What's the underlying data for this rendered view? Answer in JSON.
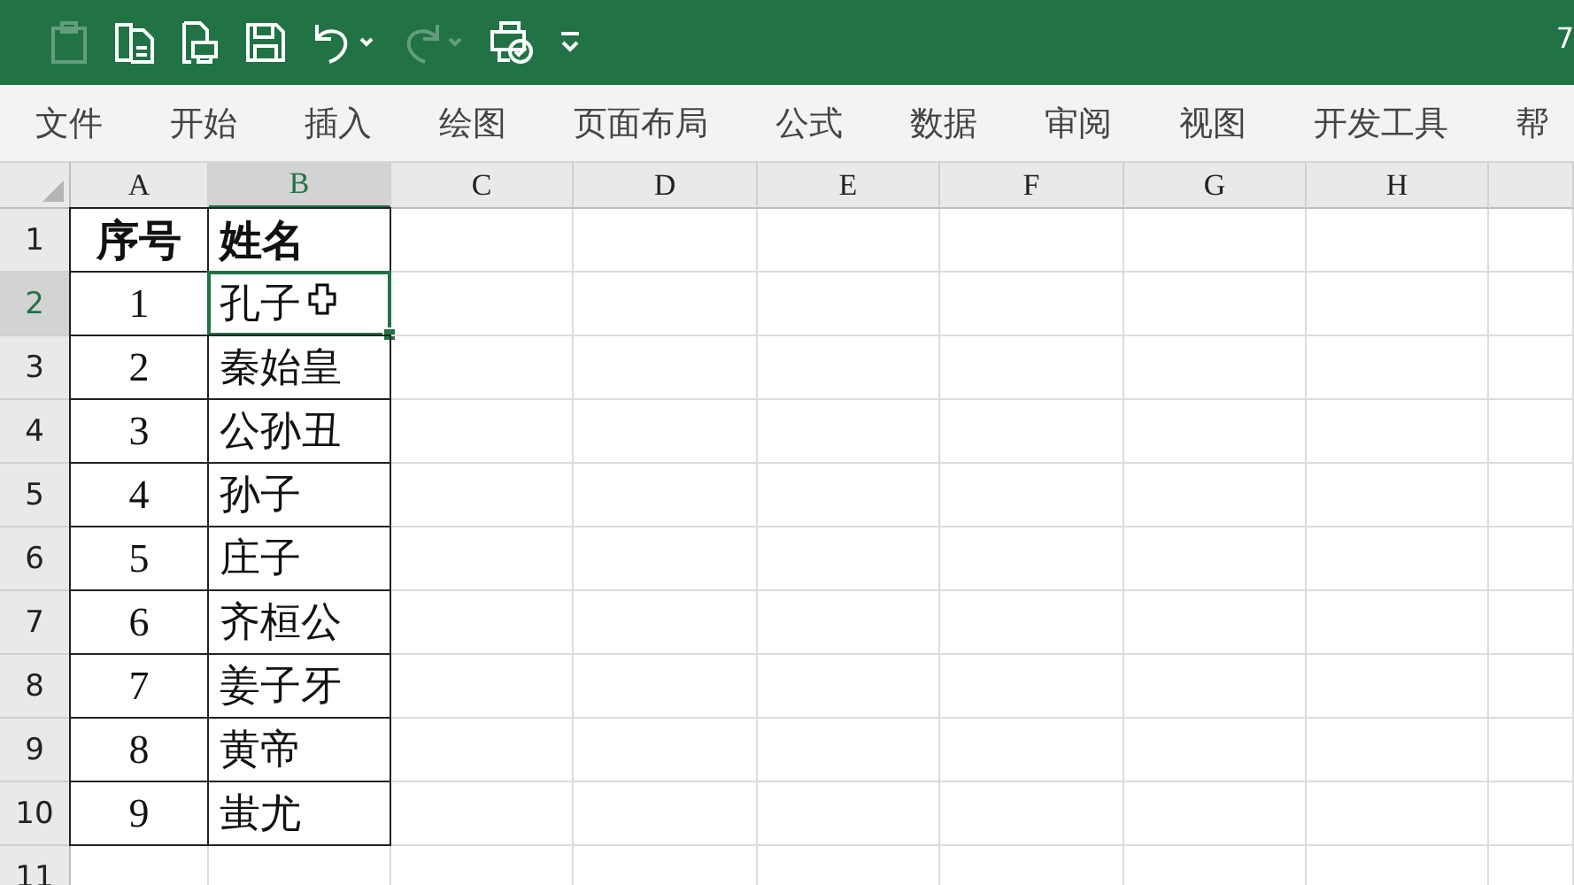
{
  "window": {
    "title": "7"
  },
  "quick_access_toolbar": [
    {
      "kind": "clipboard-numbers",
      "disabled": true
    },
    {
      "kind": "new-page",
      "disabled": false
    },
    {
      "kind": "print-preview",
      "disabled": false
    },
    {
      "kind": "save",
      "disabled": false
    },
    {
      "kind": "undo",
      "disabled": false
    },
    {
      "kind": "redo",
      "disabled": true
    },
    {
      "kind": "printer-check",
      "disabled": false
    },
    {
      "kind": "customize",
      "disabled": false
    }
  ],
  "ribbon_tabs": [
    {
      "label": "文件",
      "selected": false
    },
    {
      "label": "开始",
      "selected": false
    },
    {
      "label": "插入",
      "selected": false
    },
    {
      "label": "绘图",
      "selected": false
    },
    {
      "label": "页面布局",
      "selected": false
    },
    {
      "label": "公式",
      "selected": false
    },
    {
      "label": "数据",
      "selected": false
    },
    {
      "label": "审阅",
      "selected": false
    },
    {
      "label": "视图",
      "selected": false
    },
    {
      "label": "开发工具",
      "selected": false
    },
    {
      "label": "帮",
      "selected": false
    }
  ],
  "sheet": {
    "columns": [
      {
        "label": "A",
        "selected": false
      },
      {
        "label": "B",
        "selected": true
      },
      {
        "label": "C",
        "selected": false
      },
      {
        "label": "D",
        "selected": false
      },
      {
        "label": "E",
        "selected": false
      },
      {
        "label": "F",
        "selected": false
      },
      {
        "label": "G",
        "selected": false
      },
      {
        "label": "H",
        "selected": false
      }
    ],
    "rows": [
      {
        "number": "1",
        "selected": false,
        "cells": [
          {
            "text": "序号",
            "bold": true,
            "selected": false
          },
          {
            "text": "姓名",
            "bold": true,
            "selected": false
          }
        ]
      },
      {
        "number": "2",
        "selected": true,
        "cells": [
          {
            "text": "1",
            "bold": false,
            "selected": false
          },
          {
            "text": "孔子",
            "bold": false,
            "selected": true
          }
        ]
      },
      {
        "number": "3",
        "selected": false,
        "cells": [
          {
            "text": "2",
            "bold": false,
            "selected": false
          },
          {
            "text": "秦始皇",
            "bold": false,
            "selected": false
          }
        ]
      },
      {
        "number": "4",
        "selected": false,
        "cells": [
          {
            "text": "3",
            "bold": false,
            "selected": false
          },
          {
            "text": "公孙丑",
            "bold": false,
            "selected": false
          }
        ]
      },
      {
        "number": "5",
        "selected": false,
        "cells": [
          {
            "text": "4",
            "bold": false,
            "selected": false
          },
          {
            "text": "孙子",
            "bold": false,
            "selected": false
          }
        ]
      },
      {
        "number": "6",
        "selected": false,
        "cells": [
          {
            "text": "5",
            "bold": false,
            "selected": false
          },
          {
            "text": "庄子",
            "bold": false,
            "selected": false
          }
        ]
      },
      {
        "number": "7",
        "selected": false,
        "cells": [
          {
            "text": "6",
            "bold": false,
            "selected": false
          },
          {
            "text": "齐桓公",
            "bold": false,
            "selected": false
          }
        ]
      },
      {
        "number": "8",
        "selected": false,
        "cells": [
          {
            "text": "7",
            "bold": false,
            "selected": false
          },
          {
            "text": "姜子牙",
            "bold": false,
            "selected": false
          }
        ]
      },
      {
        "number": "9",
        "selected": false,
        "cells": [
          {
            "text": "8",
            "bold": false,
            "selected": false
          },
          {
            "text": "黄帝",
            "bold": false,
            "selected": false
          }
        ]
      },
      {
        "number": "10",
        "selected": false,
        "cells": [
          {
            "text": "9",
            "bold": false,
            "selected": false
          },
          {
            "text": "蚩尤",
            "bold": false,
            "selected": false
          }
        ]
      },
      {
        "number": "11",
        "selected": false,
        "cells": []
      }
    ]
  }
}
